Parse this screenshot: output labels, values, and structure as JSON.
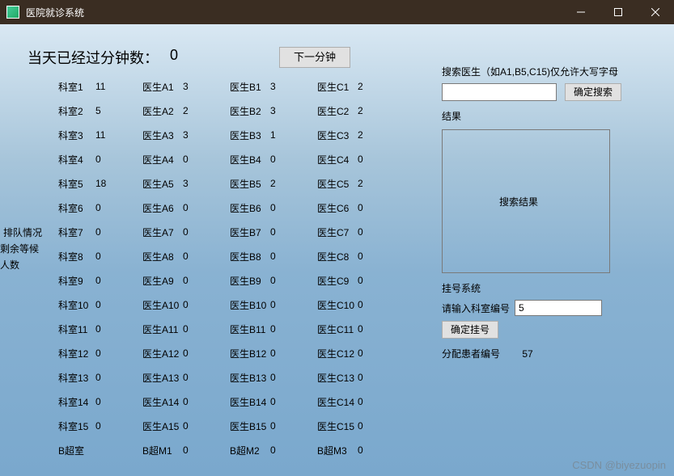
{
  "window": {
    "title": "医院就诊系统"
  },
  "header": {
    "minutes_label": "当天已经过分钟数：",
    "minutes_value": "0",
    "next_minute_btn": "下一分钟"
  },
  "side": {
    "line1": "排队情况",
    "line2": "剩余等候人数"
  },
  "departments": [
    {
      "name": "科室1",
      "count": "11"
    },
    {
      "name": "科室2",
      "count": "5"
    },
    {
      "name": "科室3",
      "count": "11"
    },
    {
      "name": "科室4",
      "count": "0"
    },
    {
      "name": "科室5",
      "count": "18"
    },
    {
      "name": "科室6",
      "count": "0"
    },
    {
      "name": "科室7",
      "count": "0"
    },
    {
      "name": "科室8",
      "count": "0"
    },
    {
      "name": "科室9",
      "count": "0"
    },
    {
      "name": "科室10",
      "count": "0"
    },
    {
      "name": "科室11",
      "count": "0"
    },
    {
      "name": "科室12",
      "count": "0"
    },
    {
      "name": "科室13",
      "count": "0"
    },
    {
      "name": "科室14",
      "count": "0"
    },
    {
      "name": "科室15",
      "count": "0"
    },
    {
      "name": "B超室",
      "count": ""
    }
  ],
  "doctors_a": [
    {
      "name": "医生A1",
      "count": "3"
    },
    {
      "name": "医生A2",
      "count": "2"
    },
    {
      "name": "医生A3",
      "count": "3"
    },
    {
      "name": "医生A4",
      "count": "0"
    },
    {
      "name": "医生A5",
      "count": "3"
    },
    {
      "name": "医生A6",
      "count": "0"
    },
    {
      "name": "医生A7",
      "count": "0"
    },
    {
      "name": "医生A8",
      "count": "0"
    },
    {
      "name": "医生A9",
      "count": "0"
    },
    {
      "name": "医生A10",
      "count": "0"
    },
    {
      "name": "医生A11",
      "count": "0"
    },
    {
      "name": "医生A12",
      "count": "0"
    },
    {
      "name": "医生A13",
      "count": "0"
    },
    {
      "name": "医生A14",
      "count": "0"
    },
    {
      "name": "医生A15",
      "count": "0"
    },
    {
      "name": "B超M1",
      "count": "0"
    }
  ],
  "doctors_b": [
    {
      "name": "医生B1",
      "count": "3"
    },
    {
      "name": "医生B2",
      "count": "3"
    },
    {
      "name": "医生B3",
      "count": "1"
    },
    {
      "name": "医生B4",
      "count": "0"
    },
    {
      "name": "医生B5",
      "count": "2"
    },
    {
      "name": "医生B6",
      "count": "0"
    },
    {
      "name": "医生B7",
      "count": "0"
    },
    {
      "name": "医生B8",
      "count": "0"
    },
    {
      "name": "医生B9",
      "count": "0"
    },
    {
      "name": "医生B10",
      "count": "0"
    },
    {
      "name": "医生B11",
      "count": "0"
    },
    {
      "name": "医生B12",
      "count": "0"
    },
    {
      "name": "医生B13",
      "count": "0"
    },
    {
      "name": "医生B14",
      "count": "0"
    },
    {
      "name": "医生B15",
      "count": "0"
    },
    {
      "name": "B超M2",
      "count": "0"
    }
  ],
  "doctors_c": [
    {
      "name": "医生C1",
      "count": "2"
    },
    {
      "name": "医生C2",
      "count": "2"
    },
    {
      "name": "医生C3",
      "count": "2"
    },
    {
      "name": "医生C4",
      "count": "0"
    },
    {
      "name": "医生C5",
      "count": "2"
    },
    {
      "name": "医生C6",
      "count": "0"
    },
    {
      "name": "医生C7",
      "count": "0"
    },
    {
      "name": "医生C8",
      "count": "0"
    },
    {
      "name": "医生C9",
      "count": "0"
    },
    {
      "name": "医生C10",
      "count": "0"
    },
    {
      "name": "医生C11",
      "count": "0"
    },
    {
      "name": "医生C12",
      "count": "0"
    },
    {
      "name": "医生C13",
      "count": "0"
    },
    {
      "name": "医生C14",
      "count": "0"
    },
    {
      "name": "医生C15",
      "count": "0"
    },
    {
      "name": "B超M3",
      "count": "0"
    }
  ],
  "search": {
    "hint": "搜索医生（如A1,B5,C15)仅允许大写字母",
    "value": "",
    "btn": "确定搜索",
    "result_label": "结果",
    "result_placeholder": "搜索结果"
  },
  "register": {
    "title": "挂号系统",
    "prompt": "请输入科室编号",
    "value": "5",
    "btn": "确定挂号",
    "assigned_label": "分配患者编号",
    "assigned_value": "57"
  },
  "watermark": "CSDN @biyezuopin"
}
